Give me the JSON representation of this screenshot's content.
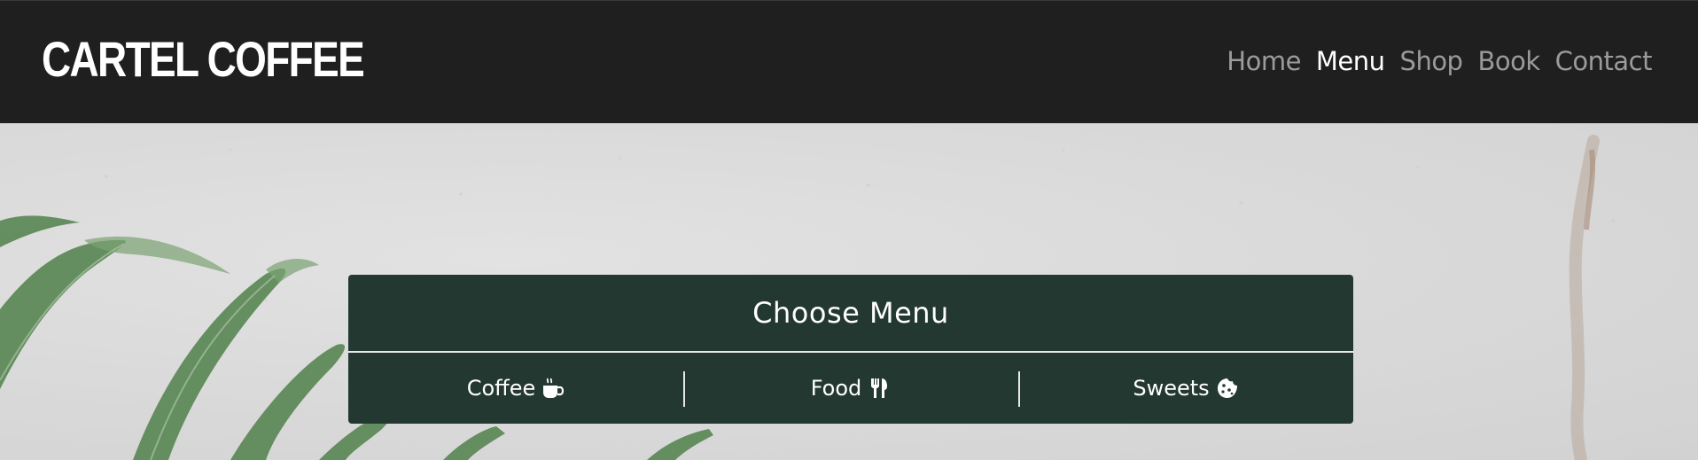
{
  "header": {
    "brand": "CARTEL COFFEE",
    "nav": [
      {
        "label": "Home",
        "active": false
      },
      {
        "label": "Menu",
        "active": true
      },
      {
        "label": "Shop",
        "active": false
      },
      {
        "label": "Book",
        "active": false
      },
      {
        "label": "Contact",
        "active": false
      }
    ]
  },
  "menu_panel": {
    "title": "Choose Menu",
    "options": [
      {
        "label": "Coffee",
        "icon": "coffee-cup-icon"
      },
      {
        "label": "Food",
        "icon": "utensils-icon"
      },
      {
        "label": "Sweets",
        "icon": "cookie-icon"
      }
    ]
  },
  "colors": {
    "header_bg": "#1f1f1f",
    "panel_bg": "#233830",
    "nav_inactive": "#9b9b9b",
    "nav_active": "#ffffff"
  }
}
